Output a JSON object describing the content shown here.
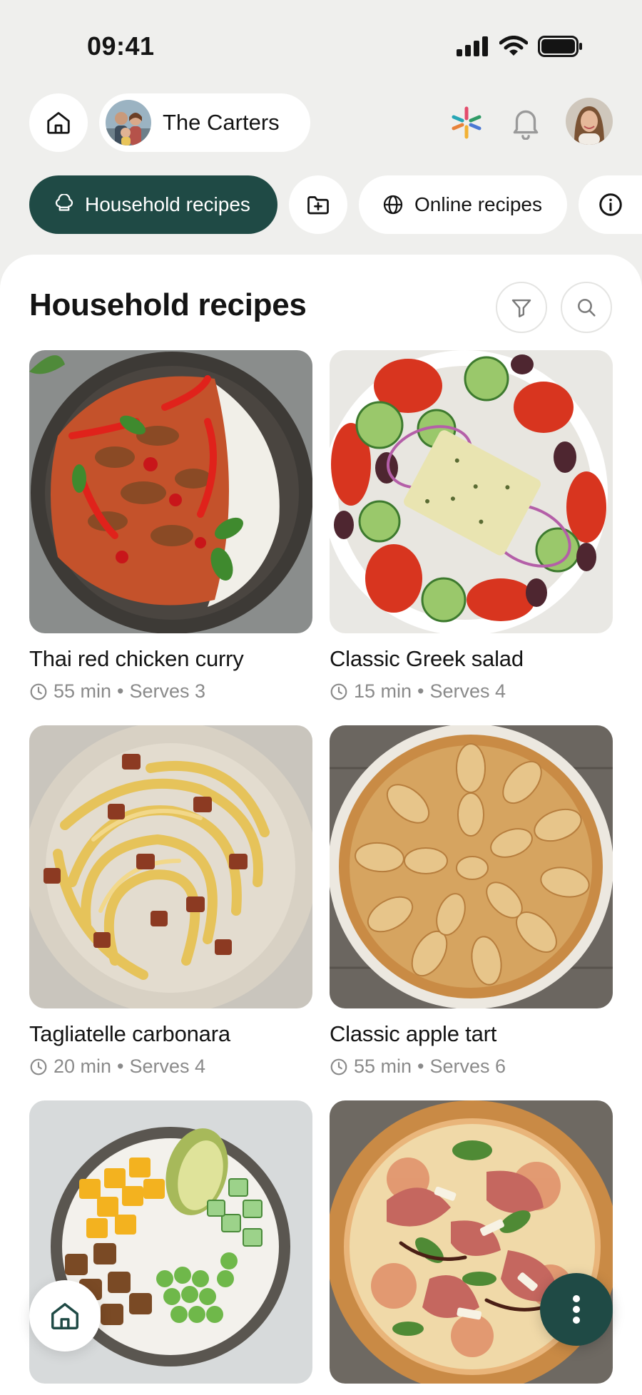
{
  "status_bar": {
    "time": "09:41",
    "icons": [
      "cellular-signal-icon",
      "wifi-icon",
      "battery-icon"
    ]
  },
  "header": {
    "home_icon": "home-icon",
    "household_name": "The Carters",
    "sparkle_icon": "sparkle-icon",
    "bell_icon": "bell-icon"
  },
  "tabs": {
    "household": "Household recipes",
    "add_folder_icon": "folder-plus-icon",
    "online": "Online recipes",
    "info_icon": "info-icon"
  },
  "main": {
    "title": "Household recipes",
    "filter_icon": "filter-icon",
    "search_icon": "search-icon"
  },
  "recipes": [
    {
      "title": "Thai red chicken curry",
      "time": "55 min",
      "sep": "•",
      "serves": "Serves 3"
    },
    {
      "title": "Classic Greek salad",
      "time": "15 min",
      "sep": "•",
      "serves": "Serves 4"
    },
    {
      "title": "Tagliatelle carbonara",
      "time": "20 min",
      "sep": "•",
      "serves": "Serves 4"
    },
    {
      "title": "Classic apple tart",
      "time": "55 min",
      "sep": "•",
      "serves": "Serves 6"
    }
  ],
  "colors": {
    "accent": "#1f4a45",
    "background": "#efefed",
    "card": "#ffffff",
    "muted": "#8a8a8a"
  }
}
